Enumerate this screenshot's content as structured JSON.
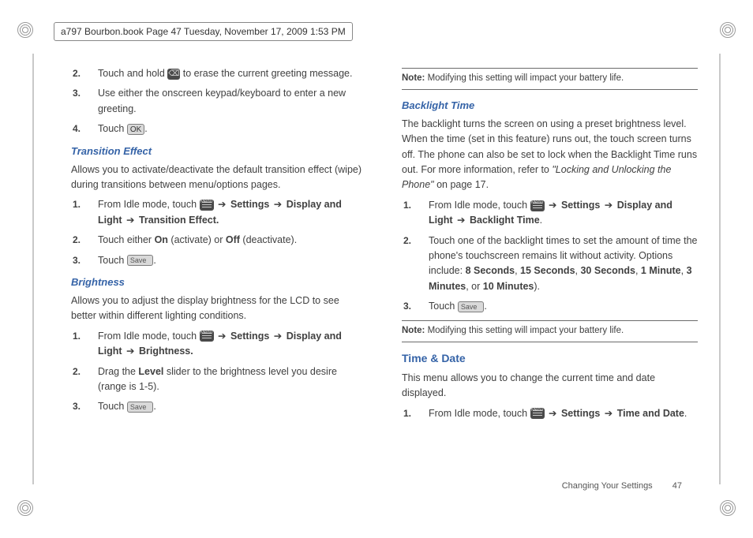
{
  "header": {
    "text": "a797 Bourbon.book  Page 47  Tuesday, November 17, 2009  1:53 PM"
  },
  "left": {
    "steps_top": [
      {
        "n": "2.",
        "pre": "Touch and hold ",
        "post": " to erase the current greeting message."
      },
      {
        "n": "3.",
        "text": "Use either the onscreen keypad/keyboard to enter a new greeting."
      },
      {
        "n": "4.",
        "pre": "Touch ",
        "btn": "OK",
        "post": "."
      }
    ],
    "transition": {
      "title": "Transition Effect",
      "intro": "Allows you to activate/deactivate the default transition effect (wipe) during transitions between menu/options pages.",
      "s1_pre": "From Idle mode, touch ",
      "s1_path_a": "Settings",
      "s1_path_b": "Display and Light",
      "s1_path_c": "Transition Effect.",
      "s2_pre": "Touch either ",
      "s2_on": "On",
      "s2_mid": " (activate) or ",
      "s2_off": "Off",
      "s2_post": " (deactivate).",
      "s3_pre": "Touch ",
      "s3_btn": "Save",
      "s3_post": "."
    },
    "brightness": {
      "title": "Brightness",
      "intro": "Allows you to adjust the display brightness for the LCD to see better within different lighting conditions.",
      "s1_pre": "From Idle mode, touch ",
      "s1_path_a": "Settings",
      "s1_path_b": "Display and Light",
      "s1_path_c": "Brightness.",
      "s2_pre": "Drag the ",
      "s2_bold": "Level",
      "s2_post": " slider to the brightness level you desire (range is 1-5).",
      "s3_pre": "Touch ",
      "s3_btn": "Save",
      "s3_post": "."
    }
  },
  "right": {
    "note1_label": "Note:",
    "note1_text": " Modifying this setting will impact your battery life.",
    "backlight": {
      "title": "Backlight Time",
      "intro_a": "The backlight turns the screen on using a preset brightness level. When the time (set in this feature) runs out, the touch screen turns off. The phone can also be set to lock when the Backlight Time runs out. For more information, refer to ",
      "intro_ital": "\"Locking and Unlocking the Phone\"",
      "intro_b": "  on page 17.",
      "s1_pre": "From Idle mode, touch ",
      "s1_path_a": "Settings",
      "s1_path_b": "Display and Light",
      "s1_path_c": "Backlight Time",
      "s2_a": "Touch one of the backlight times to set the amount of time the phone's touchscreen remains lit without activity. Options include: ",
      "opt1": "8 Seconds",
      "sep1": ", ",
      "opt2": "15 Seconds",
      "sep2": ", ",
      "opt3": "30 Seconds",
      "sep3": ", ",
      "opt4": "1 Minute",
      "sep4": ", ",
      "opt5": "3 Minutes",
      "sep5": ", or ",
      "opt6": "10 Minutes",
      "sep6": ").",
      "s3_pre": "Touch ",
      "s3_btn": "Save",
      "s3_post": "."
    },
    "note2_label": "Note:",
    "note2_text": " Modifying this setting will impact your battery life.",
    "timedate": {
      "title": "Time & Date",
      "intro": "This menu allows you to change the current time and date displayed.",
      "s1_pre": "From Idle mode, touch ",
      "s1_path_a": "Settings",
      "s1_path_b": "Time and Date",
      "s1_post": "."
    }
  },
  "footer": {
    "label": "Changing Your Settings",
    "page": "47"
  }
}
